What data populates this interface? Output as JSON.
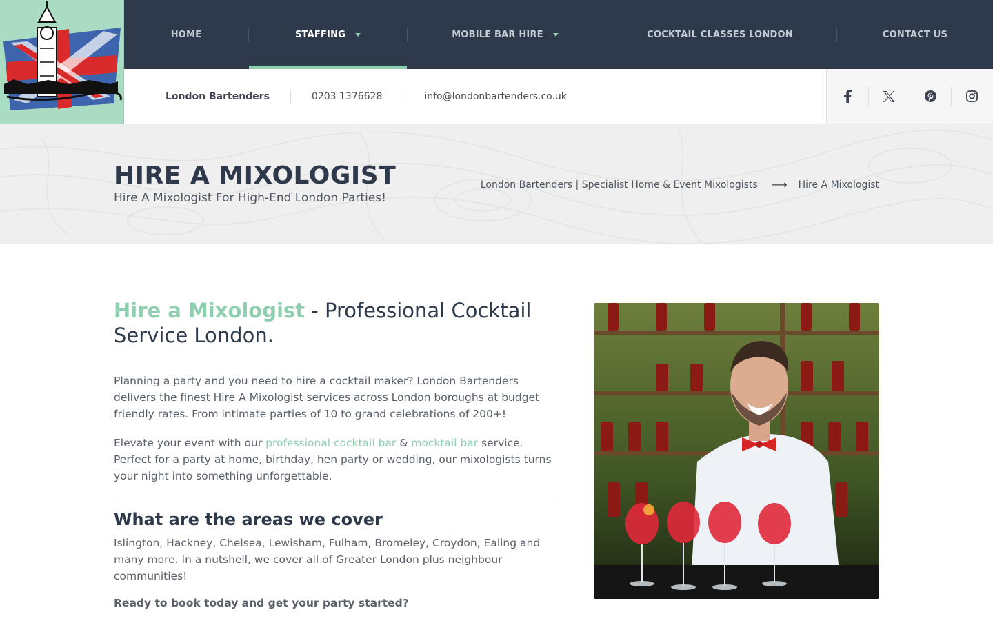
{
  "nav": {
    "items": [
      {
        "label": "HOME",
        "active": false,
        "dropdown": false
      },
      {
        "label": "STAFFING",
        "active": true,
        "dropdown": true
      },
      {
        "label": "MOBILE BAR HIRE",
        "active": false,
        "dropdown": true
      },
      {
        "label": "COCKTAIL CLASSES LONDON",
        "active": false,
        "dropdown": false
      },
      {
        "label": "CONTACT US",
        "active": false,
        "dropdown": false
      }
    ]
  },
  "infobar": {
    "brand": "London Bartenders",
    "phone": "0203 1376628",
    "email": "info@londonbartenders.co.uk"
  },
  "social": [
    "facebook-icon",
    "x-twitter-icon",
    "pinterest-icon",
    "instagram-icon"
  ],
  "hero": {
    "title": "HIRE A MIXOLOGIST",
    "subtitle": "Hire A Mixologist For High-End London Parties!",
    "breadcrumb_home": "London Bartenders | Specialist Home & Event Mixologists",
    "breadcrumb_current": "Hire A Mixologist"
  },
  "main": {
    "headline_accent": "Hire a Mixologist",
    "headline_rest": " - Professional Cocktail Service London.",
    "para1": "Planning a party and you need to hire a cocktail maker? London Bartenders delivers the finest Hire A Mixologist services across London boroughs at budget friendly rates. From intimate parties of 10 to grand celebrations of 200+!",
    "para2_start": "Elevate your event with our ",
    "link1": "professional cocktail bar",
    "amp": " & ",
    "link2": "mocktail bar",
    "para2_end": " service. Perfect for a party at home, birthday, hen party or wedding, our mixologists turns your night into something unforgettable.",
    "areas_title": "What are the areas we cover",
    "areas_text": "Islington, Hackney, Chelsea, Lewisham, Fulham, Bromeley, Croydon, Ealing and many more. In a nutshell, we cover all of Greater London plus neighbour communities!",
    "cta": "Ready to book today and get your party started?"
  },
  "colors": {
    "nav_bg": "#2e3a4b",
    "accent": "#8fcfb0",
    "hero_bg": "#efefef"
  }
}
